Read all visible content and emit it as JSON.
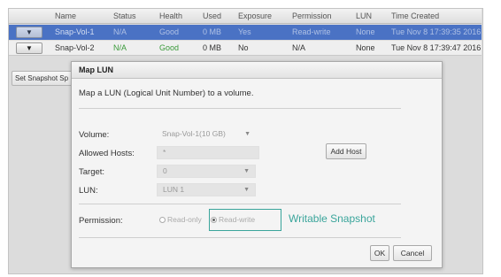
{
  "table": {
    "columns": [
      "Name",
      "Status",
      "Health",
      "Used",
      "Exposure",
      "Permission",
      "LUN",
      "Time Created"
    ],
    "rows": [
      {
        "expand": "▼",
        "name": "Snap-Vol-1",
        "status": "N/A",
        "health": "Good",
        "used": "0 MB",
        "exposure": "Yes",
        "permission": "Read-write",
        "lun": "None",
        "time_created": "Tue Nov 8 17:39:35 2016",
        "selected": true
      },
      {
        "expand": "▼",
        "name": "Snap-Vol-2",
        "status": "N/A",
        "health": "Good",
        "used": "0 MB",
        "exposure": "No",
        "permission": "N/A",
        "lun": "None",
        "time_created": "Tue Nov 8 17:39:47 2016",
        "selected": false
      }
    ]
  },
  "side_button": {
    "label": "Set Snapshot Sp"
  },
  "dialog": {
    "title": "Map LUN",
    "description": "Map a LUN (Logical Unit Number) to a volume.",
    "volume": {
      "label": "Volume:",
      "value": "Snap-Vol-1(10 GB)"
    },
    "allowed_hosts": {
      "label": "Allowed Hosts:",
      "value": "*"
    },
    "add_host": "Add Host",
    "target": {
      "label": "Target:",
      "value": "0"
    },
    "lun": {
      "label": "LUN:",
      "value": "LUN 1"
    },
    "permission": {
      "label": "Permission:",
      "options": [
        "Read-only",
        "Read-write"
      ],
      "selected": "Read-write"
    },
    "ok": "OK",
    "cancel": "Cancel"
  },
  "annotation": {
    "text": "Writable Snapshot",
    "color": "#3aa59b"
  },
  "colors": {
    "selected_row": "#4a72c4",
    "good_status": "#3a9a3a"
  },
  "icons": {
    "dropdown": "caret-down-icon",
    "expand": "expand-arrow-icon"
  }
}
